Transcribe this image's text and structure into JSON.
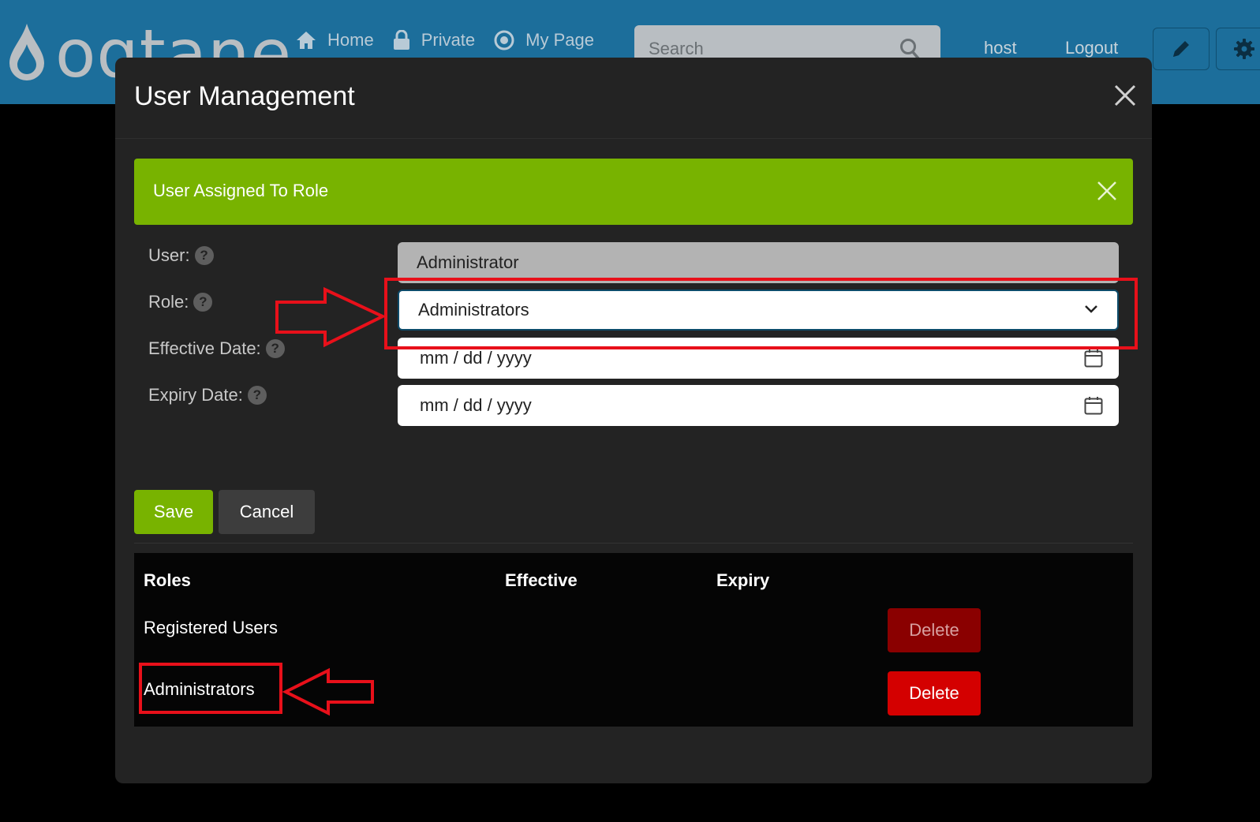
{
  "colors": {
    "navbar": "#1c6e9b",
    "modal_bg": "#232323",
    "success": "#78b300",
    "danger": "#d40000",
    "danger_dim": "#8a0000",
    "annotation": "#e8101a"
  },
  "navbar": {
    "logo_text": "oqtane",
    "links": [
      {
        "label": "Home",
        "icon": "home-icon"
      },
      {
        "label": "Private",
        "icon": "lock-icon"
      },
      {
        "label": "My Page",
        "icon": "target-icon"
      }
    ],
    "search_placeholder": "Search",
    "user": "host",
    "logout": "Logout",
    "edit_icon": "pencil-icon",
    "settings_icon": "gear-icon"
  },
  "modal": {
    "title": "User Management",
    "alert": "User Assigned To Role",
    "form": {
      "user_label": "User:",
      "user_value": "Administrator",
      "role_label": "Role:",
      "role_value": "Administrators",
      "effective_label": "Effective Date:",
      "effective_value": "mm / dd / yyyy",
      "expiry_label": "Expiry Date:",
      "expiry_value": "mm / dd / yyyy",
      "help_glyph": "?"
    },
    "save_label": "Save",
    "cancel_label": "Cancel",
    "table": {
      "headers": [
        "Roles",
        "Effective",
        "Expiry"
      ],
      "rows": [
        {
          "role": "Registered Users",
          "effective": "",
          "expiry": "",
          "action": "Delete"
        },
        {
          "role": "Administrators",
          "effective": "",
          "expiry": "",
          "action": "Delete"
        }
      ]
    }
  }
}
